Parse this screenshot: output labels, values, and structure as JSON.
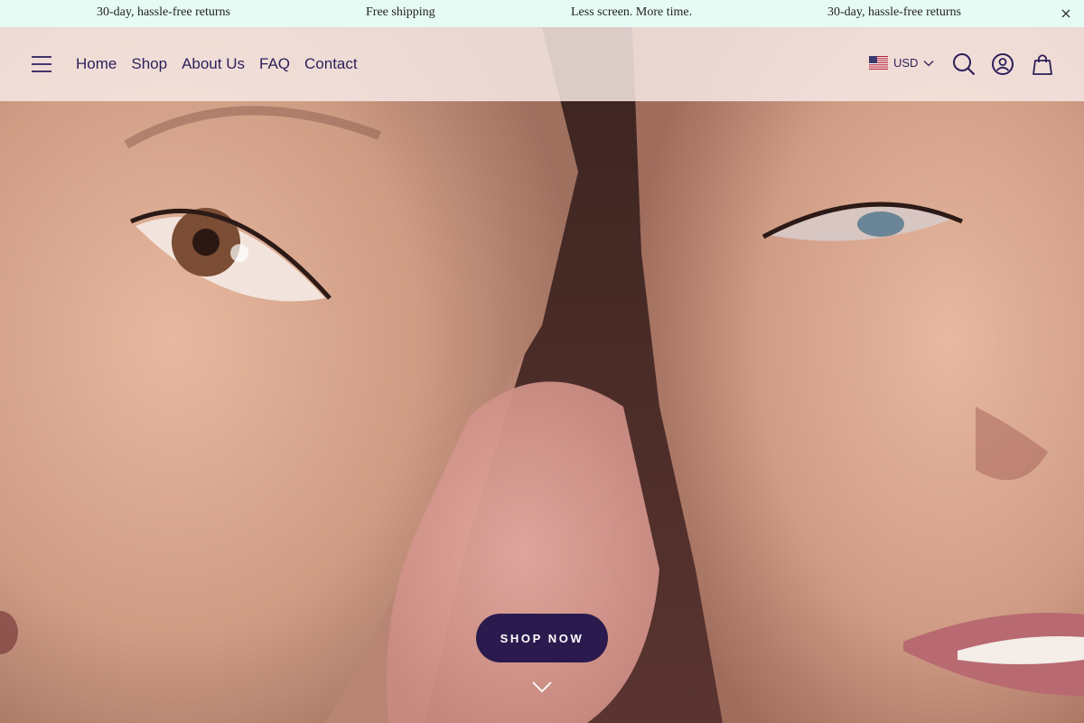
{
  "announcement": {
    "messages": [
      "30-day, hassle-free returns",
      "Free shipping",
      "Less screen. More time.",
      "30-day, hassle-free returns"
    ],
    "close_icon": "close-icon"
  },
  "header": {
    "menu_icon": "hamburger-menu-icon",
    "nav": [
      "Home",
      "Shop",
      "About Us",
      "FAQ",
      "Contact"
    ],
    "currency": {
      "code": "USD",
      "flag_icon": "us-flag-icon",
      "caret_icon": "chevron-down-icon"
    },
    "search_icon": "search-icon",
    "account_icon": "account-icon",
    "cart_icon": "shopping-bag-icon"
  },
  "hero": {
    "cta_label": "SHOP NOW",
    "scroll_icon": "chevron-down-icon"
  },
  "colors": {
    "announcement_bg": "#e6fbf3",
    "header_bg": "#f6e8e4",
    "nav_text": "#2b1f5a",
    "cta_bg": "#2a1a4e",
    "cta_text": "#ffffff"
  }
}
